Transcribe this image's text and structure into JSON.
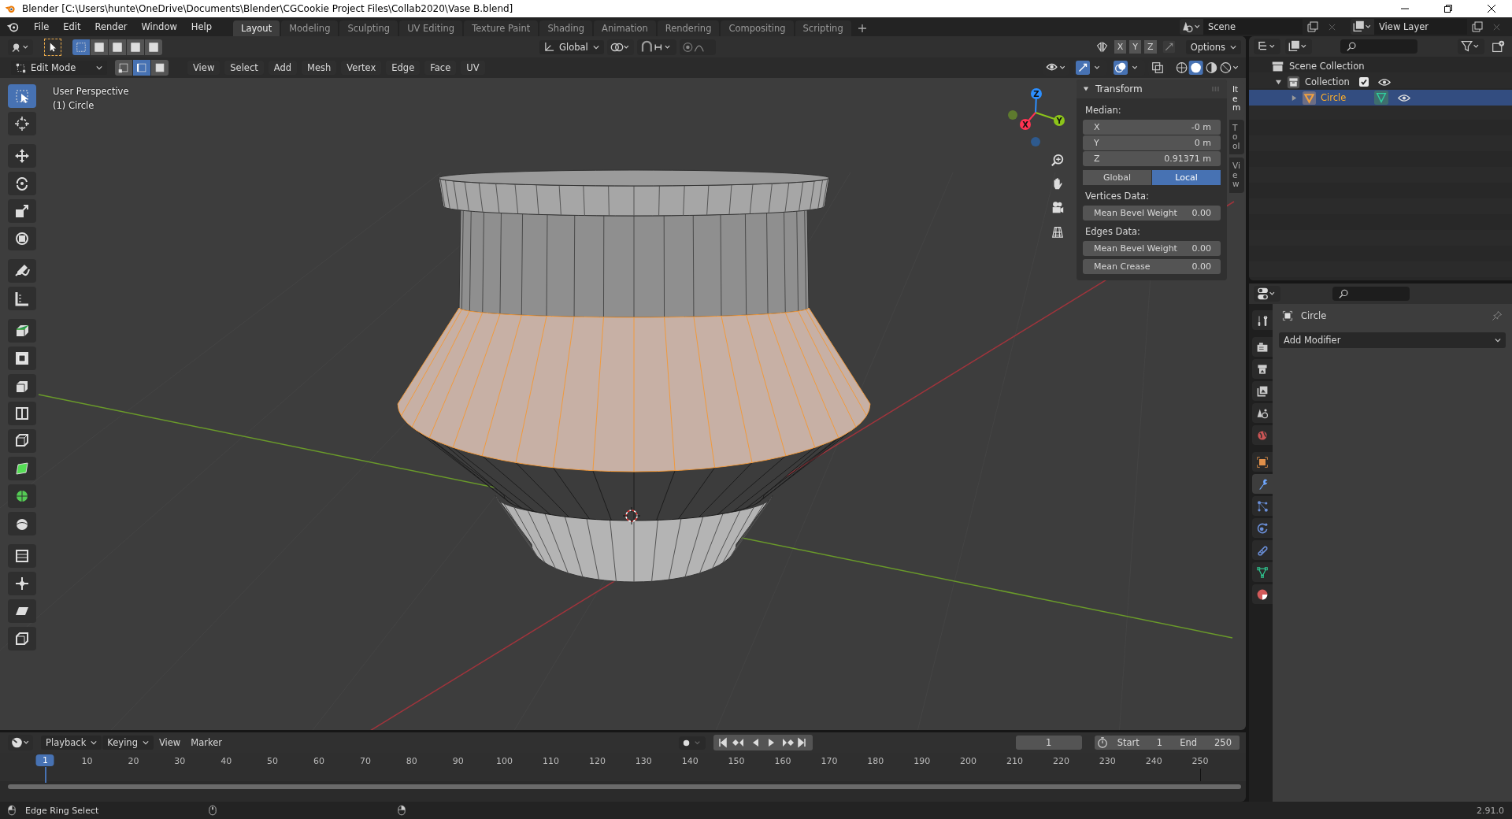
{
  "window": {
    "title": "Blender [C:\\Users\\hunte\\OneDrive\\Documents\\Blender\\CGCookie Project Files\\Collab2020\\Vase B.blend]"
  },
  "menu": [
    "File",
    "Edit",
    "Render",
    "Window",
    "Help"
  ],
  "workspaces": [
    {
      "label": "Layout",
      "selected": true
    },
    {
      "label": "Modeling",
      "selected": false
    },
    {
      "label": "Sculpting",
      "selected": false
    },
    {
      "label": "UV Editing",
      "selected": false
    },
    {
      "label": "Texture Paint",
      "selected": false
    },
    {
      "label": "Shading",
      "selected": false
    },
    {
      "label": "Animation",
      "selected": false
    },
    {
      "label": "Rendering",
      "selected": false
    },
    {
      "label": "Compositing",
      "selected": false
    },
    {
      "label": "Scripting",
      "selected": false
    }
  ],
  "scene": "Scene",
  "view_layer": "View Layer",
  "tool_header": {
    "orientation": "Global",
    "axes": [
      "X",
      "Y",
      "Z"
    ],
    "options": "Options"
  },
  "edit_header": {
    "mode": "Edit Mode",
    "select_modes": [
      {
        "kind": "vertex",
        "selected": false
      },
      {
        "kind": "edge",
        "selected": true
      },
      {
        "kind": "face",
        "selected": false
      }
    ],
    "menus": [
      "View",
      "Select",
      "Add",
      "Mesh",
      "Vertex",
      "Edge",
      "Face",
      "UV"
    ]
  },
  "viewport": {
    "view_name": "User Perspective",
    "object_label": "(1) Circle",
    "gizmo_axes": [
      "X",
      "Y",
      "Z"
    ]
  },
  "toolbar": [
    {
      "kind": "select",
      "selected": true
    },
    {
      "kind": "cursor",
      "selected": false
    },
    {
      "kind": "move",
      "selected": false
    },
    {
      "kind": "rotate",
      "selected": false
    },
    {
      "kind": "scale",
      "selected": false
    },
    {
      "kind": "transform",
      "selected": false
    },
    {
      "kind": "annotate",
      "selected": false
    },
    {
      "kind": "measure",
      "selected": false
    },
    {
      "kind": "extrude",
      "selected": false
    },
    {
      "kind": "inset",
      "selected": false
    },
    {
      "kind": "bevel",
      "selected": false
    },
    {
      "kind": "loopcut",
      "selected": false
    },
    {
      "kind": "knife",
      "selected": false
    },
    {
      "kind": "polybuild",
      "selected": false
    },
    {
      "kind": "spin",
      "selected": false
    },
    {
      "kind": "smooth",
      "selected": false
    },
    {
      "kind": "edgeslide",
      "selected": false
    },
    {
      "kind": "shrink",
      "selected": false
    },
    {
      "kind": "shear",
      "selected": false
    },
    {
      "kind": "rip",
      "selected": false
    }
  ],
  "sidebar": {
    "tabs": [
      {
        "label": "Item",
        "selected": true
      },
      {
        "label": "Tool",
        "selected": false
      },
      {
        "label": "View",
        "selected": false
      }
    ],
    "panel": {
      "title": "Transform",
      "expanded": true,
      "median_label": "Median:",
      "median": [
        {
          "axis": "X",
          "value": "-0 m"
        },
        {
          "axis": "Y",
          "value": "0 m"
        },
        {
          "axis": "Z",
          "value": "0.91371 m"
        }
      ],
      "space": [
        {
          "label": "Global",
          "selected": false
        },
        {
          "label": "Local",
          "selected": true
        }
      ],
      "vertices_label": "Vertices Data:",
      "vertices": [
        {
          "label": "Mean Bevel Weight",
          "value": "0.00"
        }
      ],
      "edges_label": "Edges Data:",
      "edges": [
        {
          "label": "Mean Bevel Weight",
          "value": "0.00"
        },
        {
          "label": "Mean Crease",
          "value": "0.00"
        }
      ]
    }
  },
  "outliner": {
    "tree": [
      {
        "label": "Scene Collection",
        "kind": "scene",
        "children": [
          {
            "label": "Collection",
            "kind": "collection",
            "expanded": true,
            "checked": true,
            "children": [
              {
                "label": "Circle",
                "kind": "mesh",
                "expanded": false,
                "selected": true
              }
            ]
          }
        ]
      }
    ]
  },
  "properties": {
    "tabs": [
      {
        "kind": "tool",
        "selected": false
      },
      {
        "kind": "render",
        "selected": false
      },
      {
        "kind": "output",
        "selected": false
      },
      {
        "kind": "viewlayer",
        "selected": false
      },
      {
        "kind": "scene",
        "selected": false
      },
      {
        "kind": "world",
        "selected": false
      },
      {
        "kind": "object",
        "selected": false
      },
      {
        "kind": "modifiers",
        "selected": true
      },
      {
        "kind": "particles",
        "selected": false
      },
      {
        "kind": "physics",
        "selected": false
      },
      {
        "kind": "constraints",
        "selected": false
      },
      {
        "kind": "data",
        "selected": false
      },
      {
        "kind": "material",
        "selected": false
      }
    ],
    "object_name": "Circle",
    "add_modifier": "Add Modifier"
  },
  "timeline": {
    "menus": [
      {
        "label": "Playback",
        "dropdown": true
      },
      {
        "label": "Keying",
        "dropdown": true
      },
      {
        "label": "View",
        "dropdown": false
      },
      {
        "label": "Marker",
        "dropdown": false
      }
    ],
    "current_frame": "1",
    "start_label": "Start",
    "start": "1",
    "end_label": "End",
    "end": "250",
    "playhead": "1",
    "ruler": [
      "10",
      "20",
      "30",
      "40",
      "50",
      "60",
      "70",
      "80",
      "90",
      "100",
      "110",
      "120",
      "130",
      "140",
      "150",
      "160",
      "170",
      "180",
      "190",
      "200",
      "210",
      "220",
      "230",
      "240",
      "250"
    ]
  },
  "status_bar": {
    "hint": "Edge Ring Select",
    "version": "2.91.0"
  }
}
